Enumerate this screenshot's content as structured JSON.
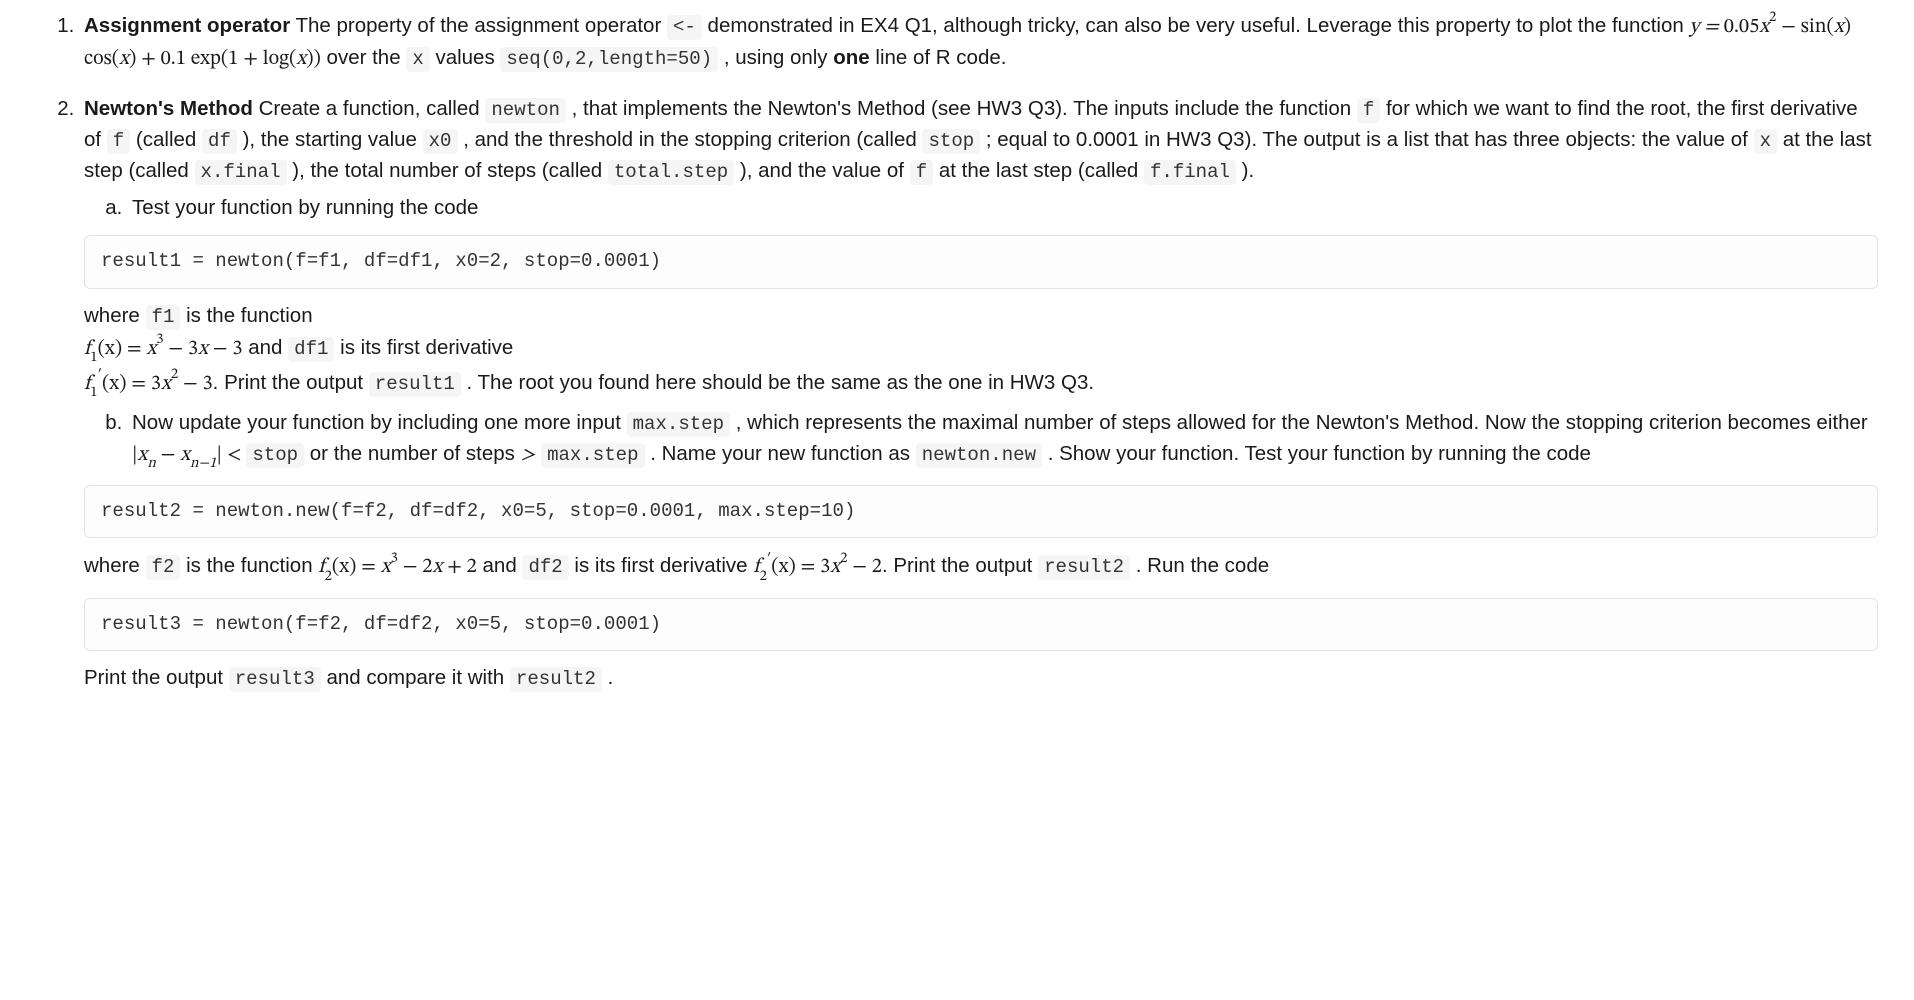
{
  "q1": {
    "title": "Assignment operator",
    "text_a": " The property of the assignment operator ",
    "code_assign": "<-",
    "text_b": " demonstrated in EX4 Q1, although tricky, can also be very useful. Leverage this property to plot the function ",
    "text_c": " over the ",
    "code_x": "x",
    "text_d": " values ",
    "code_seq": "seq(0,2,length=50)",
    "text_e": " , using only ",
    "one": "one",
    "text_f": " line of R code."
  },
  "q2": {
    "title": "Newton's Method",
    "p1_a": " Create a function, called ",
    "c_newton": "newton",
    "p1_b": " , that implements the Newton's Method (see HW3 Q3). The inputs include the function ",
    "c_f": "f",
    "p1_c": " for which we want to find the root, the first derivative of ",
    "p1_d": " (called ",
    "c_df": "df",
    "p1_e": " ), the starting value ",
    "c_x0": "x0",
    "p1_f": " , and the threshold in the stopping criterion (called ",
    "c_stop": "stop",
    "p1_g": " ; equal to 0.0001 in HW3 Q3). The output is a list that has three objects: the value of ",
    "c_x": "x",
    "p1_h": " at the last step (called ",
    "c_xfinal": "x.final",
    "p1_i": " ), the total number of steps (called ",
    "c_totalstep": "total.step",
    "p1_j": " ), and the value of ",
    "p1_k": " at the last step (called ",
    "c_ffinal": "f.final",
    "p1_l": " ).",
    "a_intro": "Test your function by running the code",
    "code1": "result1 = newton(f=f1, df=df1, x0=2, stop=0.0001)",
    "a_where_a": "where ",
    "c_f1": "f1",
    "a_where_b": " is the function",
    "a_and": " and ",
    "c_df1": "df1",
    "a_where_c": " is its first derivative",
    "a_print_a": ". Print the output ",
    "c_result1": "result1",
    "a_print_b": " . The root you found here should be the same as the one in HW3 Q3.",
    "b_intro_a": "Now update your function by including one more input ",
    "c_maxstep": "max.step",
    "b_intro_b": " , which represents the maximal number of steps allowed for the Newton's Method. Now the stopping criterion becomes either ",
    "b_intro_c": " or the number of steps ",
    "gt": ">",
    "b_intro_d": " . Name your new function as ",
    "c_newtonnew": "newton.new",
    "b_intro_e": " . Show your function. Test your function by running the code",
    "code2": "result2 = newton.new(f=f2, df=df2, x0=5, stop=0.0001, max.step=10)",
    "b_where_a": "where ",
    "c_f2": "f2",
    "b_where_b": " is the function ",
    "c_df2": "df2",
    "b_where_c": " is its first derivative ",
    "b_print_a": ". Print the output ",
    "c_result2": "result2",
    "b_print_b": " . Run the code",
    "code3": "result3 = newton(f=f2, df=df2, x0=5, stop=0.0001)",
    "final_a": "Print the output ",
    "c_result3": "result3",
    "final_b": " and compare it with ",
    "final_c": " ."
  },
  "math": {
    "q1_eq_lhs": "y = ",
    "q1_eq_a": "0.05",
    "q1_eq_xsq": "x",
    "q1_eq_sq": "2",
    "q1_eq_b": " − sin(",
    "q1_eq_c": ") cos(",
    "q1_eq_d": ") + 0.1 exp(1 + log(",
    "q1_eq_e": "))",
    "f1_lhs_a": "f",
    "sub1": "1",
    "f1_lhs_b": "(x) = ",
    "f1_rhs_a": "x",
    "sup3": "3",
    "f1_rhs_b": " − 3",
    "f1_rhs_c": " − 3",
    "f1p_lhs_a": "f",
    "prime": "′",
    "f1p_lhs_b": "(x) = 3",
    "sup2": "2",
    "f1p_rhs_b": " − 3",
    "stop_abs_a": "|",
    "xn": "x",
    "subn": "n",
    "stop_minus": " − ",
    "subnm1": "n−1",
    "stop_abs_b": "| < ",
    "f2_rhs_a": " − 2",
    "f2_rhs_b": " + 2",
    "sub2": "2",
    "f2p_rhs_b": " − 2",
    "x_letter": "x"
  }
}
